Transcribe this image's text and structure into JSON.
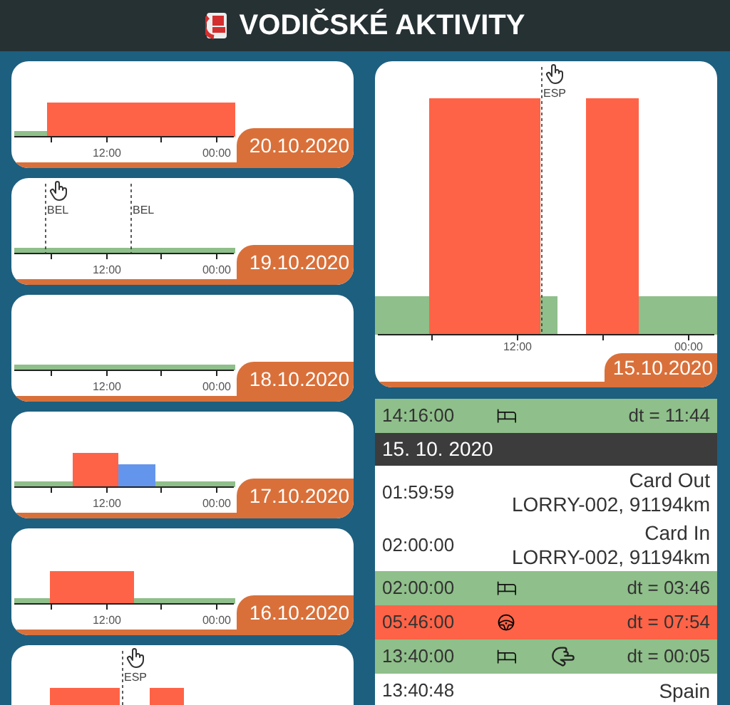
{
  "header": {
    "title": "VODIČSKÉ AKTIVITY"
  },
  "days": [
    {
      "date": "20.10.2020",
      "tick_labels": [
        "12:00",
        "00:00"
      ]
    },
    {
      "date": "19.10.2020",
      "tick_labels": [
        "12:00",
        "00:00"
      ],
      "markers": [
        {
          "label": "BEL",
          "pointer": true
        },
        {
          "label": "BEL",
          "pointer": false
        }
      ]
    },
    {
      "date": "18.10.2020",
      "tick_labels": [
        "12:00",
        "00:00"
      ]
    },
    {
      "date": "17.10.2020",
      "tick_labels": [
        "12:00",
        "00:00"
      ]
    },
    {
      "date": "16.10.2020",
      "tick_labels": [
        "12:00",
        "00:00"
      ]
    },
    {
      "markers": [
        {
          "label": "ESP",
          "pointer": true
        }
      ]
    }
  ],
  "selected_day": {
    "date": "15.10.2020",
    "tick_labels": [
      "12:00",
      "00:00"
    ],
    "markers": [
      {
        "label": "ESP",
        "pointer": true
      }
    ]
  },
  "activity_list": [
    {
      "kind": "rest",
      "time": "14:16:00",
      "duration": "dt = 11:44",
      "pointer": false
    },
    {
      "kind": "date",
      "label": "15. 10. 2020"
    },
    {
      "kind": "event",
      "time": "01:59:59",
      "lines": [
        "Card Out",
        "LORRY-002, 91194km"
      ]
    },
    {
      "kind": "event",
      "time": "02:00:00",
      "lines": [
        "Card In",
        "LORRY-002, 91194km"
      ]
    },
    {
      "kind": "rest",
      "time": "02:00:00",
      "duration": "dt = 03:46",
      "pointer": false
    },
    {
      "kind": "driving",
      "time": "05:46:00",
      "duration": "dt = 07:54",
      "pointer": false
    },
    {
      "kind": "rest",
      "time": "13:40:00",
      "duration": "dt = 00:05",
      "pointer": true
    },
    {
      "kind": "event",
      "time": "13:40:48",
      "lines": [
        "Spain"
      ]
    }
  ]
}
